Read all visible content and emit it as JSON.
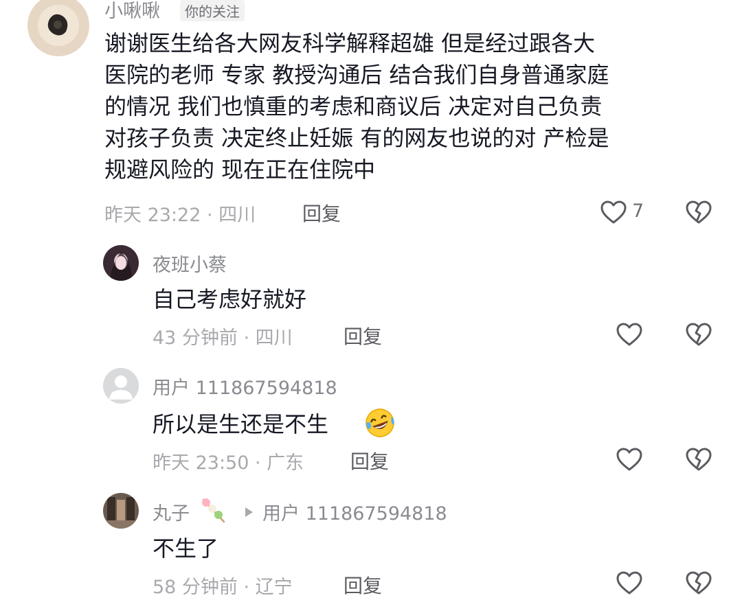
{
  "comment_main": {
    "username": "小啾啾",
    "badge": "你的关注",
    "text_lines": [
      "谢谢医生给各大网友科学解释超雄  但是经过跟各大",
      "医院的老师 专家 教授沟通后 结合我们自身普通家庭",
      "的情况 我们也慎重的考虑和商议后 决定对自己负责",
      "对孩子负责 决定终止妊娠 有的网友也说的对 产检是",
      "规避风险的 现在正在住院中"
    ],
    "meta": "昨天 23:22 · 四川",
    "reply_label": "回复",
    "like_count": "7"
  },
  "replies": [
    {
      "username": "夜班小蔡",
      "text": "自己考虑好就好",
      "meta": "43 分钟前 · 四川",
      "reply_label": "回复"
    },
    {
      "username": "用户 111867594818",
      "text": "所以是生还是不生",
      "emoji": "laughing-tears-emoji",
      "meta": "昨天 23:50 · 广东",
      "reply_label": "回复"
    },
    {
      "username": "丸子",
      "reply_to": "用户 111867594818",
      "text": "不生了",
      "meta": "58 分钟前 · 辽宁",
      "reply_label": "回复"
    }
  ],
  "icons": {
    "like": "heart-outline-icon",
    "dislike": "broken-heart-icon",
    "reply_arrow": "play-arrow-icon",
    "name_decoration": "tanghulu-icon"
  },
  "colors": {
    "text_primary": "#161823",
    "text_secondary": "#8a8b91",
    "icon": "#5a5b60"
  }
}
